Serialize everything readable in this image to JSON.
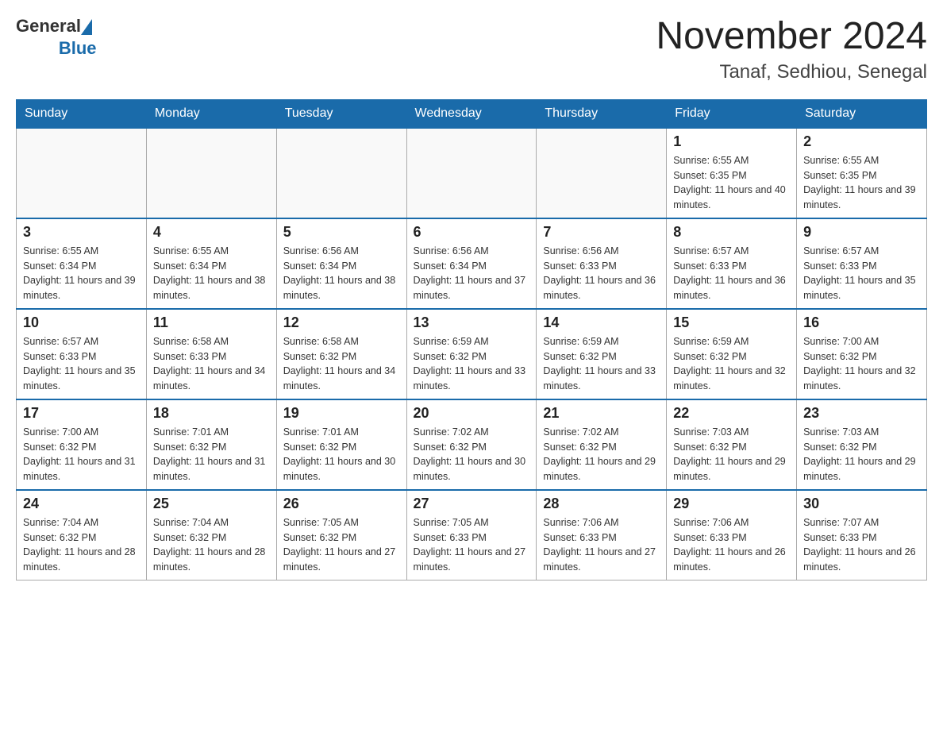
{
  "header": {
    "logo_general": "General",
    "logo_blue": "Blue",
    "title": "November 2024",
    "subtitle": "Tanaf, Sedhiou, Senegal"
  },
  "days_of_week": [
    "Sunday",
    "Monday",
    "Tuesday",
    "Wednesday",
    "Thursday",
    "Friday",
    "Saturday"
  ],
  "weeks": [
    [
      {
        "day": "",
        "info": ""
      },
      {
        "day": "",
        "info": ""
      },
      {
        "day": "",
        "info": ""
      },
      {
        "day": "",
        "info": ""
      },
      {
        "day": "",
        "info": ""
      },
      {
        "day": "1",
        "info": "Sunrise: 6:55 AM\nSunset: 6:35 PM\nDaylight: 11 hours and 40 minutes."
      },
      {
        "day": "2",
        "info": "Sunrise: 6:55 AM\nSunset: 6:35 PM\nDaylight: 11 hours and 39 minutes."
      }
    ],
    [
      {
        "day": "3",
        "info": "Sunrise: 6:55 AM\nSunset: 6:34 PM\nDaylight: 11 hours and 39 minutes."
      },
      {
        "day": "4",
        "info": "Sunrise: 6:55 AM\nSunset: 6:34 PM\nDaylight: 11 hours and 38 minutes."
      },
      {
        "day": "5",
        "info": "Sunrise: 6:56 AM\nSunset: 6:34 PM\nDaylight: 11 hours and 38 minutes."
      },
      {
        "day": "6",
        "info": "Sunrise: 6:56 AM\nSunset: 6:34 PM\nDaylight: 11 hours and 37 minutes."
      },
      {
        "day": "7",
        "info": "Sunrise: 6:56 AM\nSunset: 6:33 PM\nDaylight: 11 hours and 36 minutes."
      },
      {
        "day": "8",
        "info": "Sunrise: 6:57 AM\nSunset: 6:33 PM\nDaylight: 11 hours and 36 minutes."
      },
      {
        "day": "9",
        "info": "Sunrise: 6:57 AM\nSunset: 6:33 PM\nDaylight: 11 hours and 35 minutes."
      }
    ],
    [
      {
        "day": "10",
        "info": "Sunrise: 6:57 AM\nSunset: 6:33 PM\nDaylight: 11 hours and 35 minutes."
      },
      {
        "day": "11",
        "info": "Sunrise: 6:58 AM\nSunset: 6:33 PM\nDaylight: 11 hours and 34 minutes."
      },
      {
        "day": "12",
        "info": "Sunrise: 6:58 AM\nSunset: 6:32 PM\nDaylight: 11 hours and 34 minutes."
      },
      {
        "day": "13",
        "info": "Sunrise: 6:59 AM\nSunset: 6:32 PM\nDaylight: 11 hours and 33 minutes."
      },
      {
        "day": "14",
        "info": "Sunrise: 6:59 AM\nSunset: 6:32 PM\nDaylight: 11 hours and 33 minutes."
      },
      {
        "day": "15",
        "info": "Sunrise: 6:59 AM\nSunset: 6:32 PM\nDaylight: 11 hours and 32 minutes."
      },
      {
        "day": "16",
        "info": "Sunrise: 7:00 AM\nSunset: 6:32 PM\nDaylight: 11 hours and 32 minutes."
      }
    ],
    [
      {
        "day": "17",
        "info": "Sunrise: 7:00 AM\nSunset: 6:32 PM\nDaylight: 11 hours and 31 minutes."
      },
      {
        "day": "18",
        "info": "Sunrise: 7:01 AM\nSunset: 6:32 PM\nDaylight: 11 hours and 31 minutes."
      },
      {
        "day": "19",
        "info": "Sunrise: 7:01 AM\nSunset: 6:32 PM\nDaylight: 11 hours and 30 minutes."
      },
      {
        "day": "20",
        "info": "Sunrise: 7:02 AM\nSunset: 6:32 PM\nDaylight: 11 hours and 30 minutes."
      },
      {
        "day": "21",
        "info": "Sunrise: 7:02 AM\nSunset: 6:32 PM\nDaylight: 11 hours and 29 minutes."
      },
      {
        "day": "22",
        "info": "Sunrise: 7:03 AM\nSunset: 6:32 PM\nDaylight: 11 hours and 29 minutes."
      },
      {
        "day": "23",
        "info": "Sunrise: 7:03 AM\nSunset: 6:32 PM\nDaylight: 11 hours and 29 minutes."
      }
    ],
    [
      {
        "day": "24",
        "info": "Sunrise: 7:04 AM\nSunset: 6:32 PM\nDaylight: 11 hours and 28 minutes."
      },
      {
        "day": "25",
        "info": "Sunrise: 7:04 AM\nSunset: 6:32 PM\nDaylight: 11 hours and 28 minutes."
      },
      {
        "day": "26",
        "info": "Sunrise: 7:05 AM\nSunset: 6:32 PM\nDaylight: 11 hours and 27 minutes."
      },
      {
        "day": "27",
        "info": "Sunrise: 7:05 AM\nSunset: 6:33 PM\nDaylight: 11 hours and 27 minutes."
      },
      {
        "day": "28",
        "info": "Sunrise: 7:06 AM\nSunset: 6:33 PM\nDaylight: 11 hours and 27 minutes."
      },
      {
        "day": "29",
        "info": "Sunrise: 7:06 AM\nSunset: 6:33 PM\nDaylight: 11 hours and 26 minutes."
      },
      {
        "day": "30",
        "info": "Sunrise: 7:07 AM\nSunset: 6:33 PM\nDaylight: 11 hours and 26 minutes."
      }
    ]
  ]
}
